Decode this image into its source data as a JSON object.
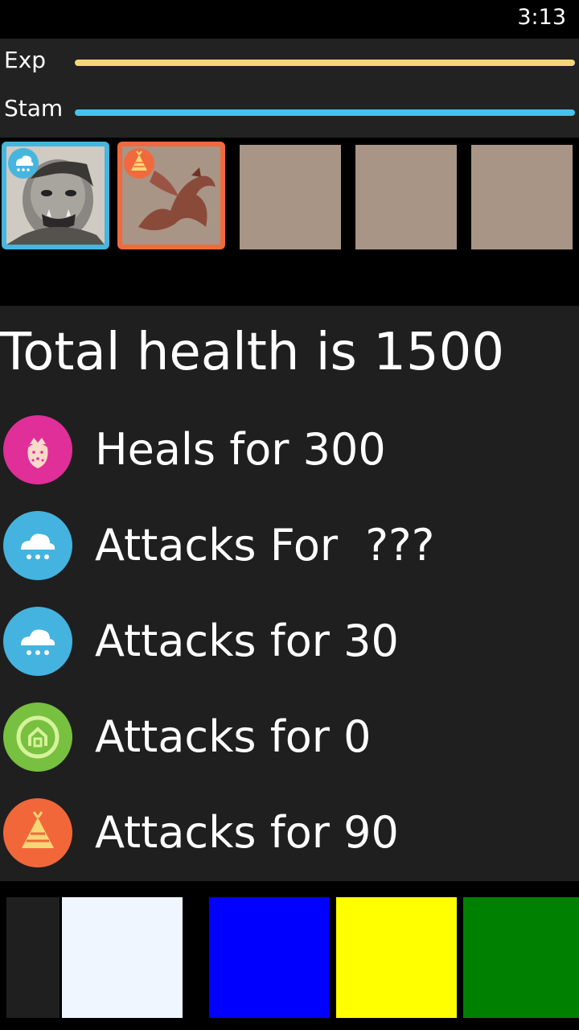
{
  "status": {
    "time": "3:13"
  },
  "stats": {
    "exp_label": "Exp",
    "stam_label": "Stam",
    "exp_fraction": 1.0,
    "stam_fraction": 1.0,
    "exp_color": "#f6d776",
    "stam_color": "#44c3ef"
  },
  "team": {
    "slots": [
      {
        "state": "filled",
        "creature": "orc",
        "element": "snow-cloud-icon",
        "border_color": "#46b6de"
      },
      {
        "state": "filled",
        "creature": "dragon",
        "element": "tent-icon",
        "border_color": "#f06a3d"
      },
      {
        "state": "empty"
      },
      {
        "state": "empty"
      },
      {
        "state": "empty"
      }
    ]
  },
  "info": {
    "total_health": "Total health is 1500",
    "abilities": [
      {
        "icon": "strawberry-icon",
        "color": "#e02f99",
        "text": "Heals for 300"
      },
      {
        "icon": "snow-cloud-icon",
        "color": "#44b3e0",
        "text": "Attacks For  ???"
      },
      {
        "icon": "snow-cloud-icon",
        "color": "#44b3e0",
        "text": "Attacks for 30"
      },
      {
        "icon": "leaf-house-icon",
        "color": "#78c040",
        "text": "Attacks for 0"
      },
      {
        "icon": "tent-icon",
        "color": "#f2673a",
        "text": "Attacks for 90"
      }
    ]
  },
  "palette": {
    "swatches": [
      {
        "color": "#1f1f1f"
      },
      {
        "color": "#f0f6ff"
      },
      {
        "color": "#0000ff"
      },
      {
        "color": "#ffff00"
      },
      {
        "color": "#008000"
      }
    ]
  }
}
